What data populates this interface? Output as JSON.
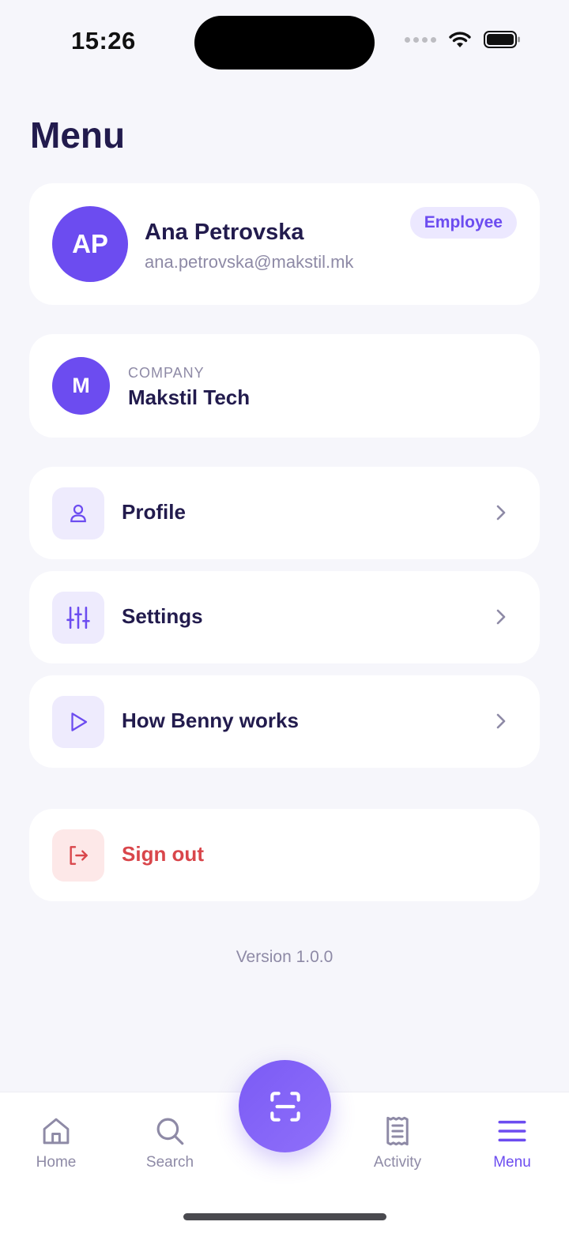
{
  "status_bar": {
    "time": "15:26"
  },
  "page_title": "Menu",
  "user": {
    "initials": "AP",
    "name": "Ana Petrovska",
    "email": "ana.petrovska@makstil.mk",
    "role": "Employee"
  },
  "company": {
    "initial": "M",
    "label": "COMPANY",
    "name": "Makstil Tech"
  },
  "menu_items": [
    {
      "label": "Profile",
      "icon": "person-icon"
    },
    {
      "label": "Settings",
      "icon": "sliders-icon"
    },
    {
      "label": "How Benny works",
      "icon": "play-icon"
    }
  ],
  "sign_out": {
    "label": "Sign out",
    "icon": "logout-icon"
  },
  "version": "Version 1.0.0",
  "tabs": [
    {
      "label": "Home",
      "icon": "home-icon"
    },
    {
      "label": "Search",
      "icon": "search-icon"
    },
    {
      "label": "Activity",
      "icon": "receipt-icon"
    },
    {
      "label": "Menu",
      "icon": "hamburger-icon",
      "active": true
    }
  ],
  "colors": {
    "accent": "#6C4CF0",
    "background": "#F6F6FB",
    "text_primary": "#221B4D",
    "text_secondary": "#8E8AA6",
    "danger": "#D9464B"
  }
}
